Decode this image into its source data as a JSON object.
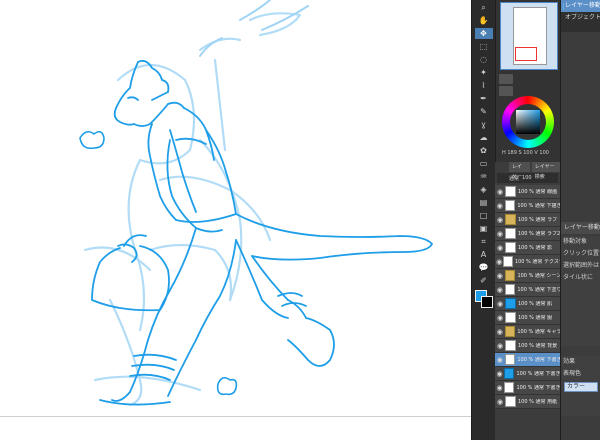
{
  "app": {
    "name": "CLIP STUDIO PAINT"
  },
  "colors": {
    "sketch_blue": "#1e9ee8",
    "sketch_light": "#9fd4f5",
    "ui_dark": "#2b2b2b",
    "ui_mid": "#3c3c3c",
    "selection": "#5b8fc7"
  },
  "toolbar": {
    "tools": [
      {
        "icon": "zoom-icon",
        "glyph": "⌕"
      },
      {
        "icon": "hand-icon",
        "glyph": "✋"
      },
      {
        "icon": "move-icon",
        "glyph": "✥"
      },
      {
        "icon": "transform-icon",
        "glyph": "⬚"
      },
      {
        "icon": "lasso-icon",
        "glyph": "◌"
      },
      {
        "icon": "magic-wand-icon",
        "glyph": "✦"
      },
      {
        "icon": "eyedropper-icon",
        "glyph": "⌇"
      },
      {
        "icon": "pen-icon",
        "glyph": "✒"
      },
      {
        "icon": "pencil-icon",
        "glyph": "✎"
      },
      {
        "icon": "brush-icon",
        "glyph": "ɣ"
      },
      {
        "icon": "airbrush-icon",
        "glyph": "☁"
      },
      {
        "icon": "decoration-icon",
        "glyph": "✿"
      },
      {
        "icon": "eraser-icon",
        "glyph": "▭"
      },
      {
        "icon": "blend-icon",
        "glyph": "♒"
      },
      {
        "icon": "fill-icon",
        "glyph": "◈"
      },
      {
        "icon": "gradient-icon",
        "glyph": "▤"
      },
      {
        "icon": "figure-icon",
        "glyph": "□"
      },
      {
        "icon": "frame-icon",
        "glyph": "▣"
      },
      {
        "icon": "ruler-icon",
        "glyph": "⌗"
      },
      {
        "icon": "text-icon",
        "glyph": "A"
      },
      {
        "icon": "balloon-icon",
        "glyph": "💬"
      },
      {
        "icon": "correct-line-icon",
        "glyph": "✐"
      }
    ]
  },
  "color_wheel": {
    "values_text": "H 189 S 100 V 100",
    "main_color": "#1e9ee8"
  },
  "subtool": {
    "header": "レイヤー移動",
    "items": [
      {
        "label": "レイヤー移動",
        "selected": true
      },
      {
        "label": "オブジェクト",
        "selected": false
      },
      {
        "label": "移動対象",
        "selected": false
      }
    ],
    "detail": [
      {
        "label": "移動対象"
      },
      {
        "label": "クリック位置で"
      },
      {
        "label": "選択範囲外は"
      },
      {
        "label": "タイル状に"
      }
    ],
    "effect_header": "効果",
    "expression_label": "表現色",
    "expression_value": "カラー"
  },
  "layers": {
    "tabs": [
      "レイヤー",
      "レイヤー検索"
    ],
    "blend_mode": "通常",
    "opacity": "100",
    "items": [
      {
        "name": "100 % 通常 線画",
        "type": "plain"
      },
      {
        "name": "100 % 通常 下描き",
        "type": "plain"
      },
      {
        "name": "100 % 通常 ラフ",
        "type": "folder"
      },
      {
        "name": "100 % 通常 ラフ2",
        "type": "plain"
      },
      {
        "name": "100 % 通常 影",
        "type": "plain"
      },
      {
        "name": "100 % 通常 テクスチャ",
        "type": "plain"
      },
      {
        "name": "100 % 通常 シーン",
        "type": "folder"
      },
      {
        "name": "100 % 通常 下塗り",
        "type": "plain"
      },
      {
        "name": "100 % 通常 肌",
        "type": "color"
      },
      {
        "name": "100 % 通常 服",
        "type": "plain"
      },
      {
        "name": "100 % 通常 キャラ",
        "type": "folder"
      },
      {
        "name": "100 % 通常 背景",
        "type": "plain"
      },
      {
        "name": "100 % 通常 下書き",
        "type": "plain",
        "selected": true
      },
      {
        "name": "100 % 通常 下書き2",
        "type": "color"
      },
      {
        "name": "100 % 通常 下書き3",
        "type": "plain"
      },
      {
        "name": "100 % 通常 用紙",
        "type": "plain"
      }
    ]
  }
}
